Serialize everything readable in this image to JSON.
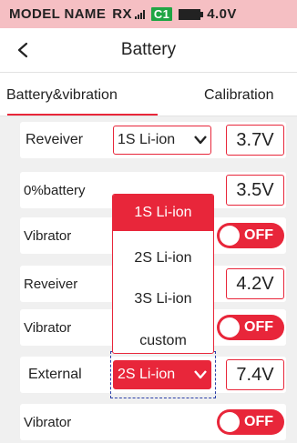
{
  "status_bar": {
    "model_name": "MODEL NAME",
    "rx": "RX",
    "channel": "C1",
    "voltage": "4.0V",
    "background_color": "#f5bfc3",
    "icons": [
      "signal-icon",
      "battery-icon"
    ]
  },
  "header": {
    "back_icon": "chevron-left-icon",
    "title": "Battery"
  },
  "tabs": [
    {
      "label": "Battery&vibration",
      "active": true
    },
    {
      "label": "Calibration",
      "active": false
    }
  ],
  "rows": {
    "receiver_1": {
      "label": "Reveiver",
      "select_value": "1S Li-ion",
      "value": "3.7V"
    },
    "zero_percent": {
      "label": "0%battery",
      "value": "3.5V"
    },
    "vibrator_1": {
      "label": "Vibrator",
      "toggle": "OFF"
    },
    "receiver_2": {
      "label": "Reveiver",
      "value": "4.2V"
    },
    "vibrator_2": {
      "label": "Vibrator",
      "toggle": "OFF"
    },
    "external": {
      "label": "External",
      "select_value": "2S Li-ion",
      "value": "7.4V"
    },
    "vibrator_3": {
      "label": "Vibrator",
      "toggle": "OFF"
    }
  },
  "dropdown": {
    "options": [
      "1S Li-ion",
      "2S Li-ion",
      "3S Li-ion",
      "custom"
    ],
    "selected": "1S Li-ion"
  },
  "colors": {
    "accent": "#e8263a",
    "content_background": "#f0f0f0",
    "focus_outline": "#2a3fa8",
    "channel_badge": "#1fa544"
  }
}
